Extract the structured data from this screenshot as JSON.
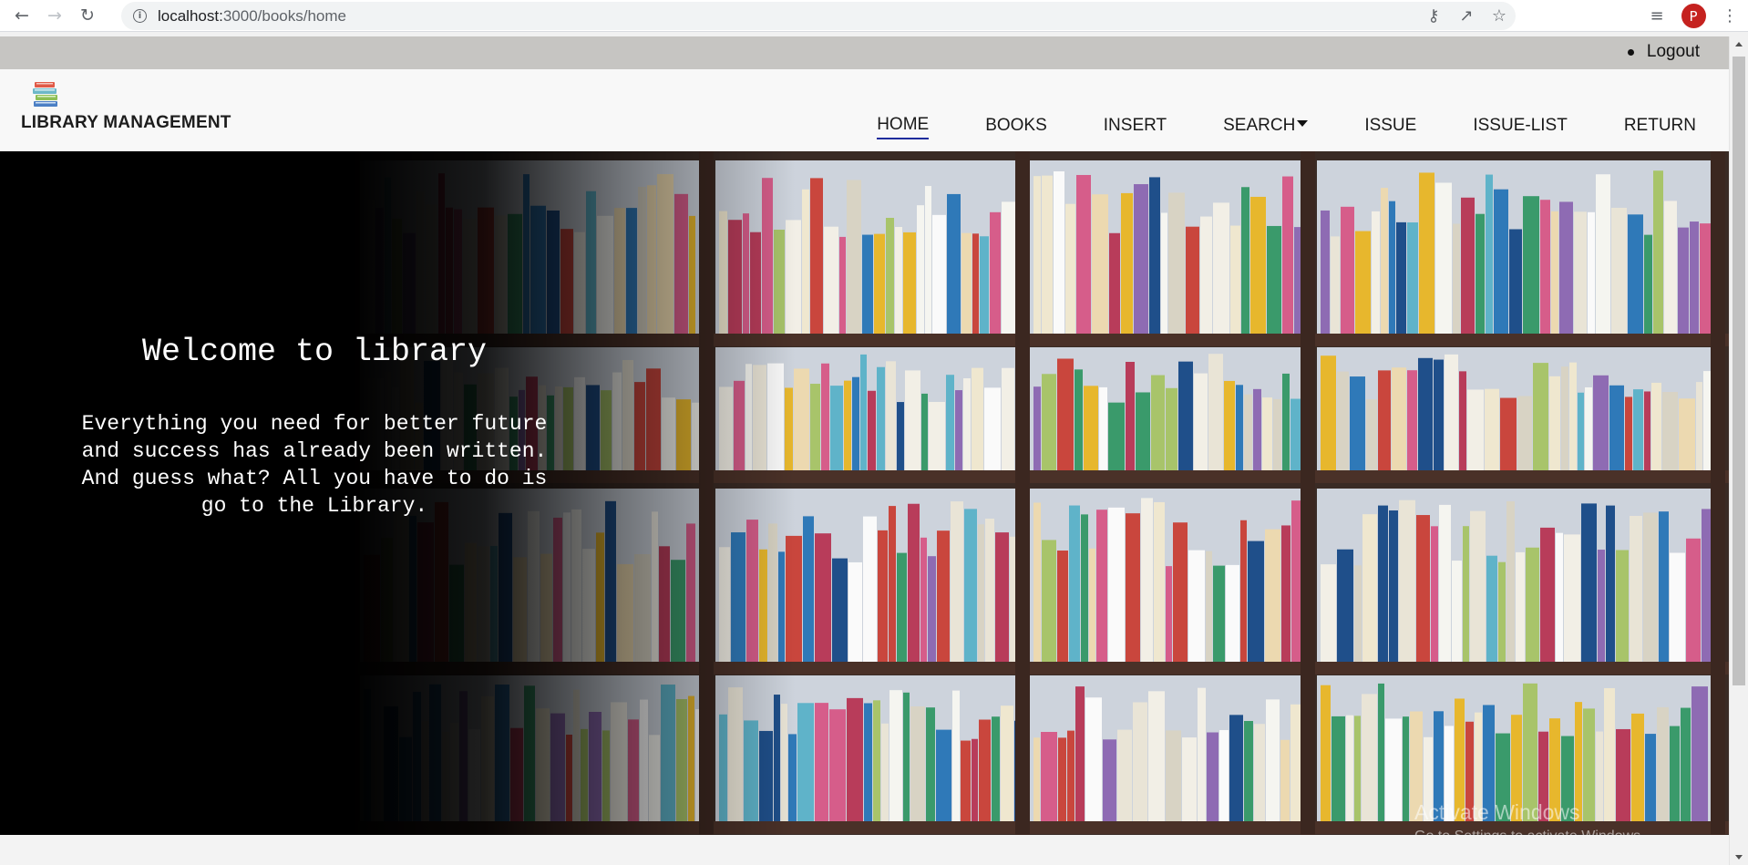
{
  "browser": {
    "url_host": "localhost:",
    "url_port_path": "3000/books/home",
    "avatar_letter": "P",
    "icons": [
      "back-arrow-icon",
      "forward-arrow-icon",
      "reload-icon",
      "info-icon",
      "key-icon",
      "share-icon",
      "star-icon",
      "reading-list-icon",
      "kebab-menu-icon"
    ]
  },
  "topbar": {
    "logout_label": "Logout"
  },
  "header": {
    "brand": "LIBRARY MANAGEMENT",
    "nav": [
      {
        "label": "HOME",
        "active": true
      },
      {
        "label": "BOOKS"
      },
      {
        "label": "INSERT"
      },
      {
        "label": "SEARCH",
        "dropdown": true
      },
      {
        "label": "ISSUE"
      },
      {
        "label": "ISSUE-LIST"
      },
      {
        "label": "RETURN"
      }
    ]
  },
  "hero": {
    "title": "Welcome to library",
    "lines": [
      "Everything you need for better future",
      "and success has already been written.",
      "And guess what? All you have to do is",
      "go to the Library."
    ]
  },
  "watermark": {
    "title": "Activate Windows",
    "subtitle": "Go to Settings to activate Windows."
  },
  "colors": {
    "strip": "#c6c5c2",
    "header_bg": "#f8f8f8",
    "active_underline": "#1e2c9c",
    "avatar": "#c5221f"
  }
}
